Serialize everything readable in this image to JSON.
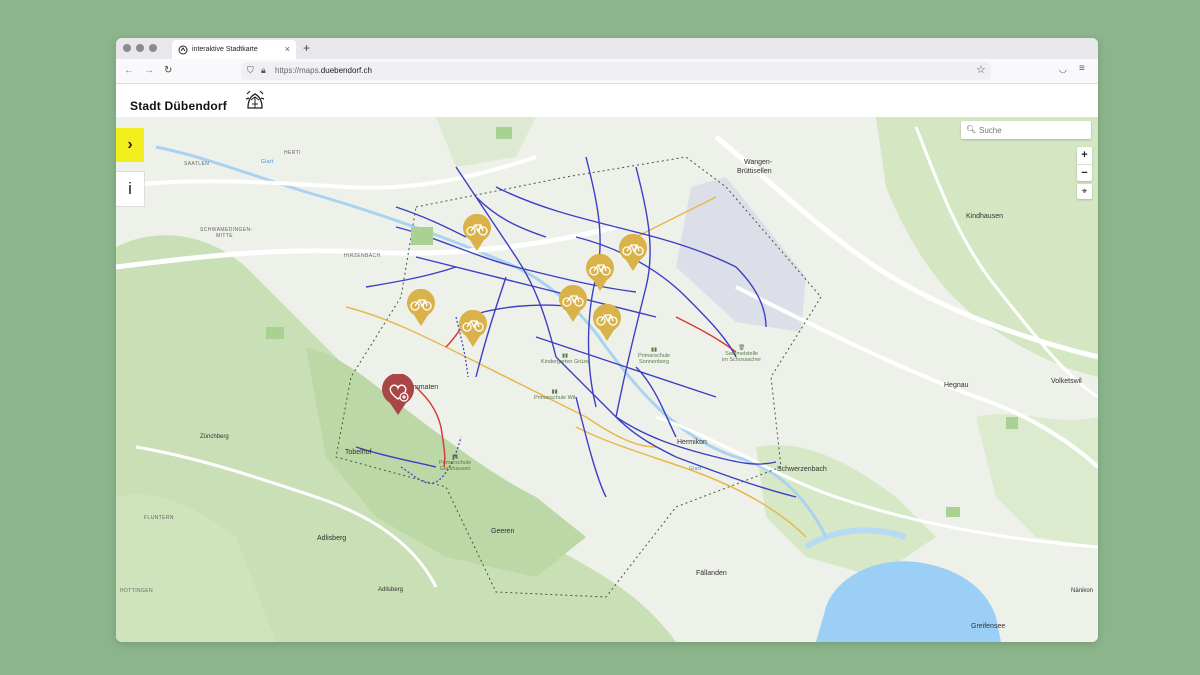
{
  "browser": {
    "tab_title": "interaktive Stadtkarte",
    "tab_close": "×",
    "new_tab": "+",
    "url_prefix": "https://maps.",
    "url_domain": "duebendorf.ch"
  },
  "site": {
    "title": "Stadt Dübendorf"
  },
  "map": {
    "search_placeholder": "Suche",
    "zoom_in": "+",
    "zoom_out": "−",
    "sidebar_toggle": "›",
    "info": "i",
    "labels": {
      "herti": "HERTI",
      "saatlen": "SAATLEN",
      "schwamendingen": "SCHWAMEDINGEN-",
      "mitte": "MITTE",
      "hirzenbach": "HIRZENBACH",
      "wangen1": "Wangen-",
      "wangen2": "Brüttisellen",
      "kindhausen": "Kindhausen",
      "hegnau": "Hegnau",
      "volketswil": "Volketswil",
      "gockhausen": "ammaten",
      "zuerichberg": "Zürichberg",
      "tobelhof": "Tobelhof",
      "fluntern": "FLUNTERN",
      "adlisberg": "Adlisberg",
      "adlisberg_peak": "Adlisberg",
      "hottingen": "HOTTINGEN",
      "geeren": "Geeren",
      "hermikon": "Hermikon",
      "schwerzenbach": "Schwerzenbach",
      "faellanden": "Fällanden",
      "greifensee": "Greifensee",
      "naenikon": "Nänikon",
      "school_sonnenberg_1": "Primarschule",
      "school_sonnenberg_2": "Sonnenberg",
      "sammelstelle_1": "Sammelstelle",
      "sammelstelle_2": "im Schossacher",
      "kindergarten": "Kindergarten Grüze",
      "school_wil": "Primarschule Wil",
      "school_gockhausen_1": "Primarschule",
      "school_gockhausen_2": "Gockhausen",
      "glatt": "Glatt",
      "glatt2": "Glatt"
    },
    "colors": {
      "route_blue": "#3c3fc4",
      "route_yellow": "#e8b84a",
      "route_red": "#d63a3a",
      "pin": "#d9b24a",
      "heart_pin": "#a94747",
      "water": "#9ccff6",
      "airfield": "#dcdfe8"
    }
  }
}
